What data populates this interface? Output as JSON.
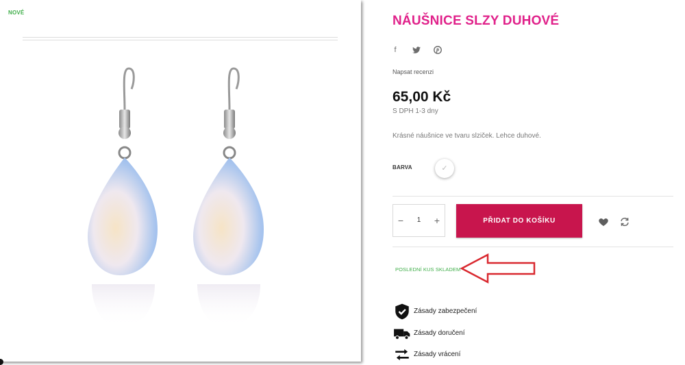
{
  "product": {
    "badge": "NOVÉ",
    "title": "NÁUŠNICE SLZY DUHOVÉ",
    "review_link": "Napsat recenzi",
    "price": "65,00 Kč",
    "tax_delivery": "S DPH 1-3 dny",
    "description": "Krásné náušnice ve tvaru slziček. Lehce duhové.",
    "color_label": "BARVA",
    "color_selected_icon": "check-icon"
  },
  "social": {
    "facebook": "f",
    "twitter": "twitter-icon",
    "pinterest": "pinterest-icon"
  },
  "cart": {
    "minus": "−",
    "quantity": "1",
    "plus": "+",
    "add_label": "PŘIDAT DO KOŠÍKU"
  },
  "availability": {
    "stock_text": "POSLEDNÍ KUS SKLADEM"
  },
  "policies": [
    {
      "icon": "shield-check-icon",
      "label": "Zásady zabezpečení"
    },
    {
      "icon": "truck-icon",
      "label": "Zásady doručení"
    },
    {
      "icon": "exchange-arrows-icon",
      "label": "Zásady vrácení"
    }
  ],
  "colors": {
    "title": "#e0218a",
    "button": "#c8154d",
    "stock": "#3fae49",
    "annotation_arrow": "#d9282f"
  }
}
